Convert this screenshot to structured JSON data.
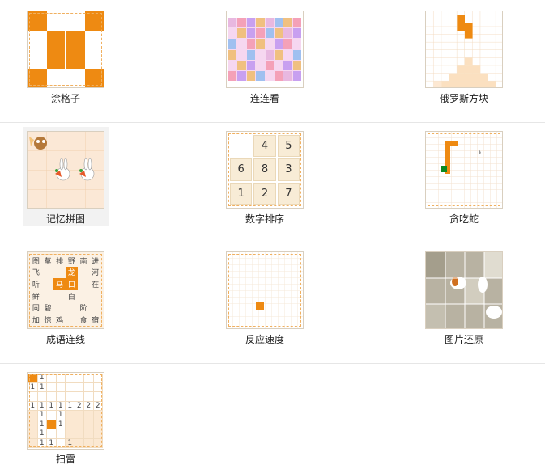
{
  "games": [
    {
      "id": "coloring",
      "label": "涂格子"
    },
    {
      "id": "link",
      "label": "连连看"
    },
    {
      "id": "tetris",
      "label": "俄罗斯方块"
    },
    {
      "id": "memory",
      "label": "记忆拼图"
    },
    {
      "id": "number-sort",
      "label": "数字排序"
    },
    {
      "id": "snake",
      "label": "贪吃蛇"
    },
    {
      "id": "idiom",
      "label": "成语连线"
    },
    {
      "id": "reaction",
      "label": "反应速度"
    },
    {
      "id": "picture",
      "label": "图片还原"
    },
    {
      "id": "minesweeper",
      "label": "扫雷"
    }
  ],
  "number_sort_cells": [
    "",
    "4",
    "5",
    "6",
    "8",
    "3",
    "1",
    "2",
    "7"
  ],
  "idiom_chars": [
    "图",
    "草",
    "排",
    "野",
    "南",
    "进",
    "飞",
    "",
    "",
    "龙",
    "",
    "河",
    "听",
    "",
    "马",
    "口",
    "",
    "在",
    "鲜",
    "",
    "",
    "白",
    "",
    "",
    "同",
    "碧",
    "",
    "",
    "阶",
    "",
    "加",
    "惊",
    "鸡",
    "",
    "食",
    "宿"
  ],
  "mine_rows": [
    [
      "■",
      "1",
      "",
      "",
      "",
      "",
      "",
      ""
    ],
    [
      "1",
      "1",
      "",
      "",
      "",
      "",
      "",
      ""
    ],
    [
      "",
      "",
      "",
      "",
      "",
      "",
      "",
      ""
    ],
    [
      "1",
      "1",
      "1",
      "1",
      "1",
      "2",
      "2",
      "2"
    ],
    [
      "",
      "1",
      "",
      "1",
      "",
      "",
      "",
      ""
    ],
    [
      "",
      "1",
      "",
      "1",
      "",
      "",
      "",
      ""
    ],
    [
      "",
      "1",
      "",
      "",
      "",
      "",
      "",
      ""
    ],
    [
      "",
      "1",
      "1",
      "",
      "1",
      "",
      "",
      ""
    ]
  ],
  "colors": {
    "accent": "#ee8a12",
    "pale": "#fbe8d2",
    "separator": "#e6e6e6"
  }
}
